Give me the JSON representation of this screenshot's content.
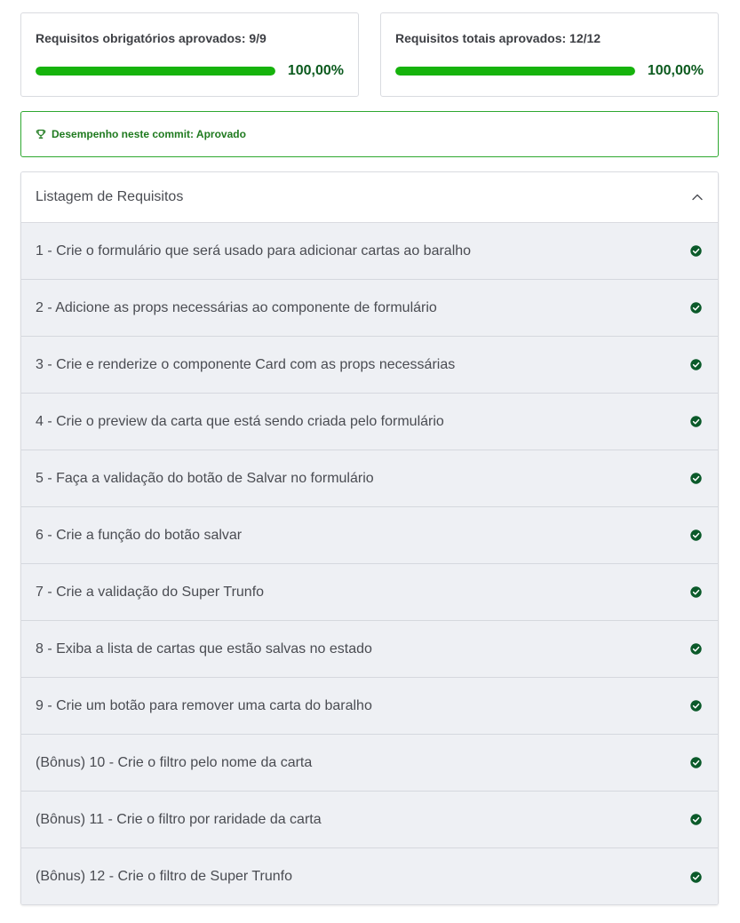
{
  "summary": {
    "mandatory": {
      "title": "Requisitos obrigatórios aprovados: 9/9",
      "progress": 1.0,
      "value": "100,00%"
    },
    "total": {
      "title": "Requisitos totais aprovados: 12/12",
      "progress": 1.0,
      "value": "100,00%"
    }
  },
  "performance": {
    "icon": "trophy-icon",
    "text": "Desempenho neste commit: Aprovado"
  },
  "requirements": {
    "title": "Listagem de Requisitos",
    "toggle_icon": "chevron-up-icon",
    "items": [
      {
        "label": "1 - Crie o formulário que será usado para adicionar cartas ao baralho",
        "status": "passed"
      },
      {
        "label": "2 - Adicione as props necessárias ao componente de formulário",
        "status": "passed"
      },
      {
        "label": "3 - Crie e renderize o componente Card com as props necessárias",
        "status": "passed"
      },
      {
        "label": "4 - Crie o preview da carta que está sendo criada pelo formulário",
        "status": "passed"
      },
      {
        "label": "5 - Faça a validação do botão de Salvar no formulário",
        "status": "passed"
      },
      {
        "label": "6 - Crie a função do botão salvar",
        "status": "passed"
      },
      {
        "label": "7 - Crie a validação do Super Trunfo",
        "status": "passed"
      },
      {
        "label": "8 - Exiba a lista de cartas que estão salvas no estado",
        "status": "passed"
      },
      {
        "label": "9 - Crie um botão para remover uma carta do baralho",
        "status": "passed"
      },
      {
        "label": "(Bônus) 10 - Crie o filtro pelo nome da carta",
        "status": "passed"
      },
      {
        "label": "(Bônus) 11 - Crie o filtro por raridade da carta",
        "status": "passed"
      },
      {
        "label": "(Bônus) 12 - Crie o filtro de Super Trunfo",
        "status": "passed"
      }
    ]
  },
  "colors": {
    "progress": "#16b30c",
    "success_text": "#0b5a1e",
    "banner_border": "#2ea830",
    "check": "#0b5a2a"
  }
}
